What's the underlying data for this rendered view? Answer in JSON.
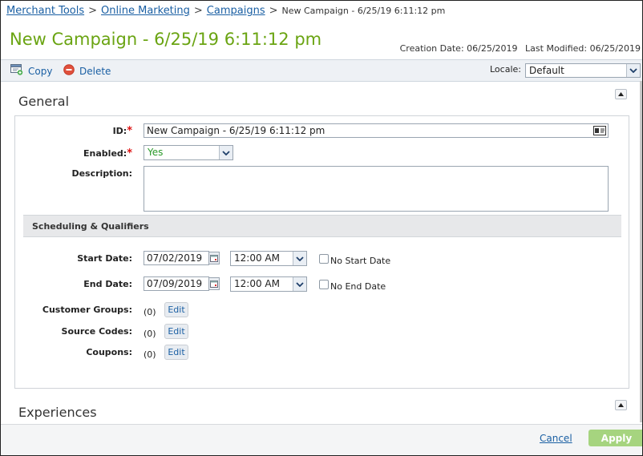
{
  "breadcrumb": {
    "items": [
      "Merchant Tools",
      "Online Marketing",
      "Campaigns"
    ],
    "separator": ">",
    "current": "New Campaign - 6/25/19 6:11:12 pm"
  },
  "page": {
    "title": "New Campaign - 6/25/19 6:11:12 pm",
    "creation_date": "Creation Date: 06/25/2019",
    "last_modified": "Last Modified: 06/25/2019"
  },
  "toolbar": {
    "copy_label": "Copy",
    "delete_label": "Delete",
    "locale_label": "Locale:",
    "locale_value": "Default"
  },
  "general": {
    "heading": "General",
    "id_label": "ID:",
    "id_value": "New Campaign - 6/25/19 6:11:12 pm",
    "enabled_label": "Enabled:",
    "enabled_value": "Yes",
    "description_label": "Description:",
    "description_value": "",
    "required_mark": "*"
  },
  "scheduling": {
    "heading": "Scheduling & Qualifiers",
    "start_label": "Start Date:",
    "start_date": "07/02/2019",
    "start_time": "12:00 AM",
    "no_start_label": "No Start Date",
    "end_label": "End Date:",
    "end_date": "07/09/2019",
    "end_time": "12:00 AM",
    "no_end_label": "No End Date",
    "customer_groups_label": "Customer Groups:",
    "customer_groups_count": "(0)",
    "source_codes_label": "Source Codes:",
    "source_codes_count": "(0)",
    "coupons_label": "Coupons:",
    "coupons_count": "(0)",
    "edit_label": "Edit"
  },
  "experiences": {
    "heading": "Experiences"
  },
  "footer": {
    "cancel_label": "Cancel",
    "apply_label": "Apply"
  },
  "colors": {
    "title": "#6aa412",
    "link": "#1a5fa3",
    "required": "#d11111",
    "apply": "#a6d47f",
    "enabled_value": "#2a9a2a"
  }
}
